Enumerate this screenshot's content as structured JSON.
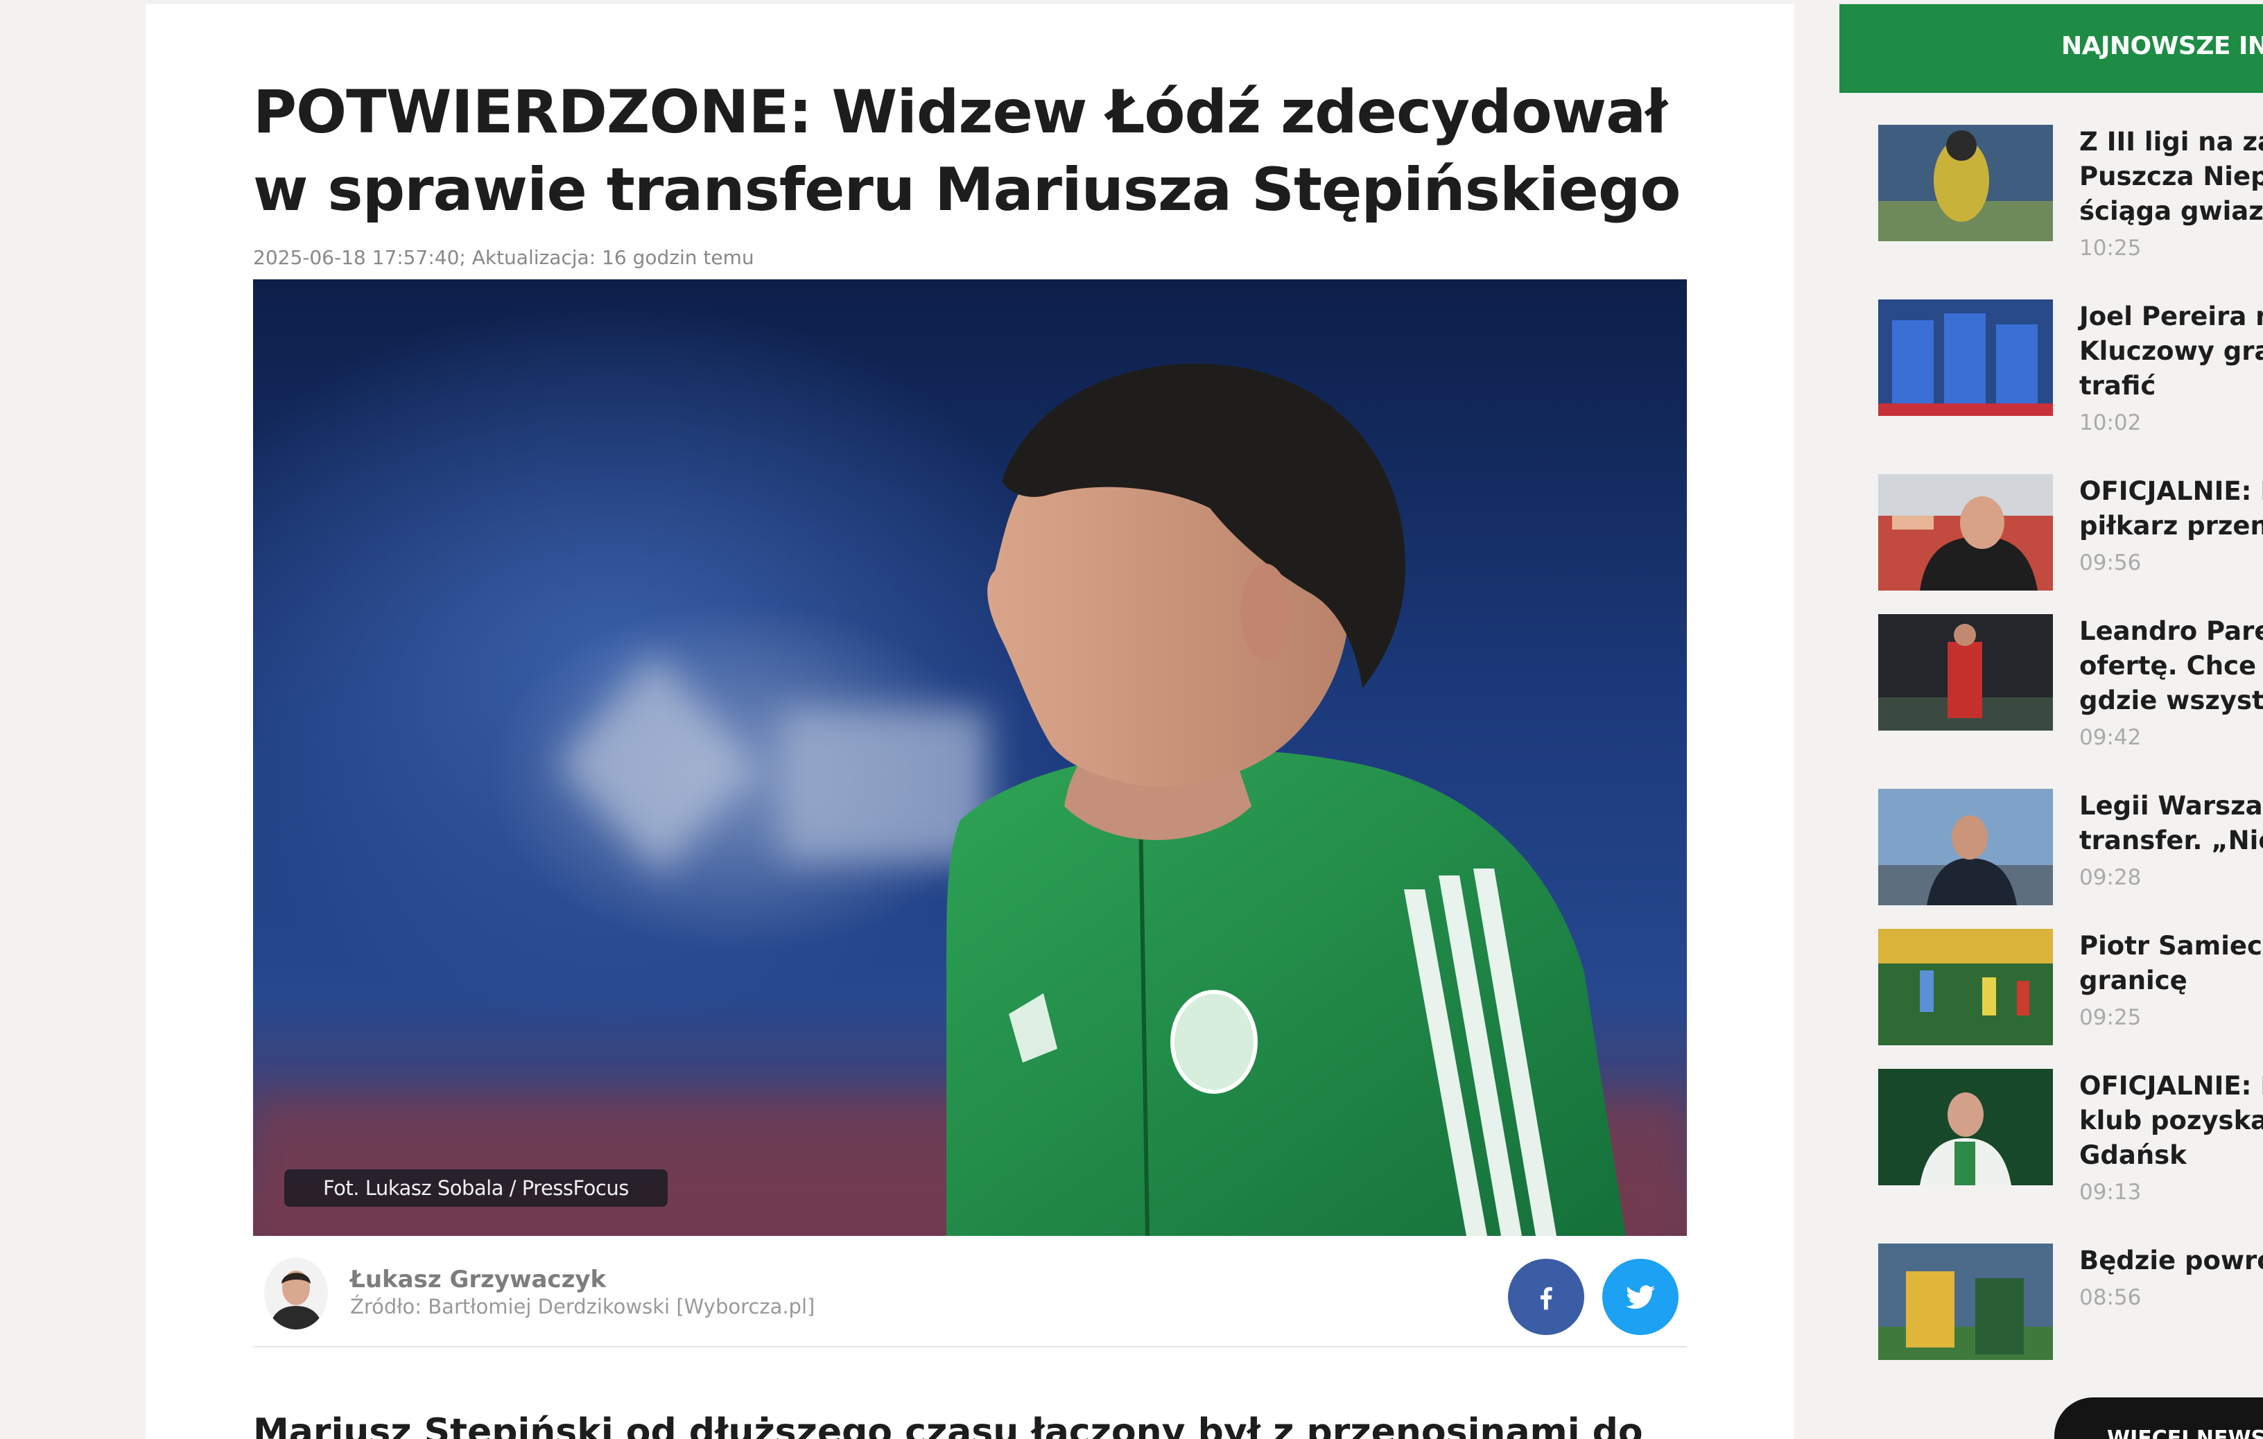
{
  "article": {
    "title": "POTWIERDZONE: Widzew Łódź zdecydował w sprawie transferu Mariusza Stępińskiego",
    "meta": "2025-06-18 17:57:40; Aktualizacja: 16 godzin temu",
    "photo_credit": "Fot. Lukasz Sobala / PressFocus",
    "author_name": "Łukasz Grzywaczyk",
    "source_label": "Źródło:",
    "source_value": "Bartłomiej Derdzikowski [Wyborcza.pl]",
    "lead_text": "Mariusz Stępiński od dłuższego czasu łączony był z przenosinami do",
    "share": {
      "facebook_icon": "facebook-icon",
      "twitter_icon": "twitter-icon"
    },
    "colors": {
      "facebook": "#3b5da5",
      "twitter": "#1da1f2"
    }
  },
  "sidebar": {
    "header": "NAJNOWSZE INFORMACJE",
    "accent_color": "#1e8c45",
    "more_label": "WIĘCEJ NEWSÓW",
    "items": [
      {
        "title": "Z III ligi na zaplecze. Puszcza Niepołomice ściąga gwiazdę zespołu",
        "time": "10:25"
      },
      {
        "title": "Joel Pereira na celowniku. Kluczowy gracz może tam trafić",
        "time": "10:02"
      },
      {
        "title": "OFICJALNIE: Kolejny piłkarz przeniósł się do",
        "time": "09:56"
      },
      {
        "title": "Leandro Paredes odrzucił ofertę. Chce wrócić tam, gdzie wszystko zaczął",
        "time": "09:42"
      },
      {
        "title": "Legii Warszawa grozi transfer. „Nie ma szans\"",
        "time": "09:28"
      },
      {
        "title": "Piotr Samiec-Talar za granicę",
        "time": "09:25"
      },
      {
        "title": "OFICJALNIE: Lechia nowy klub pozyskał Lechia Gdańsk",
        "time": "09:13"
      },
      {
        "title": "Będzie powrót do klubu",
        "time": "08:56"
      }
    ]
  }
}
